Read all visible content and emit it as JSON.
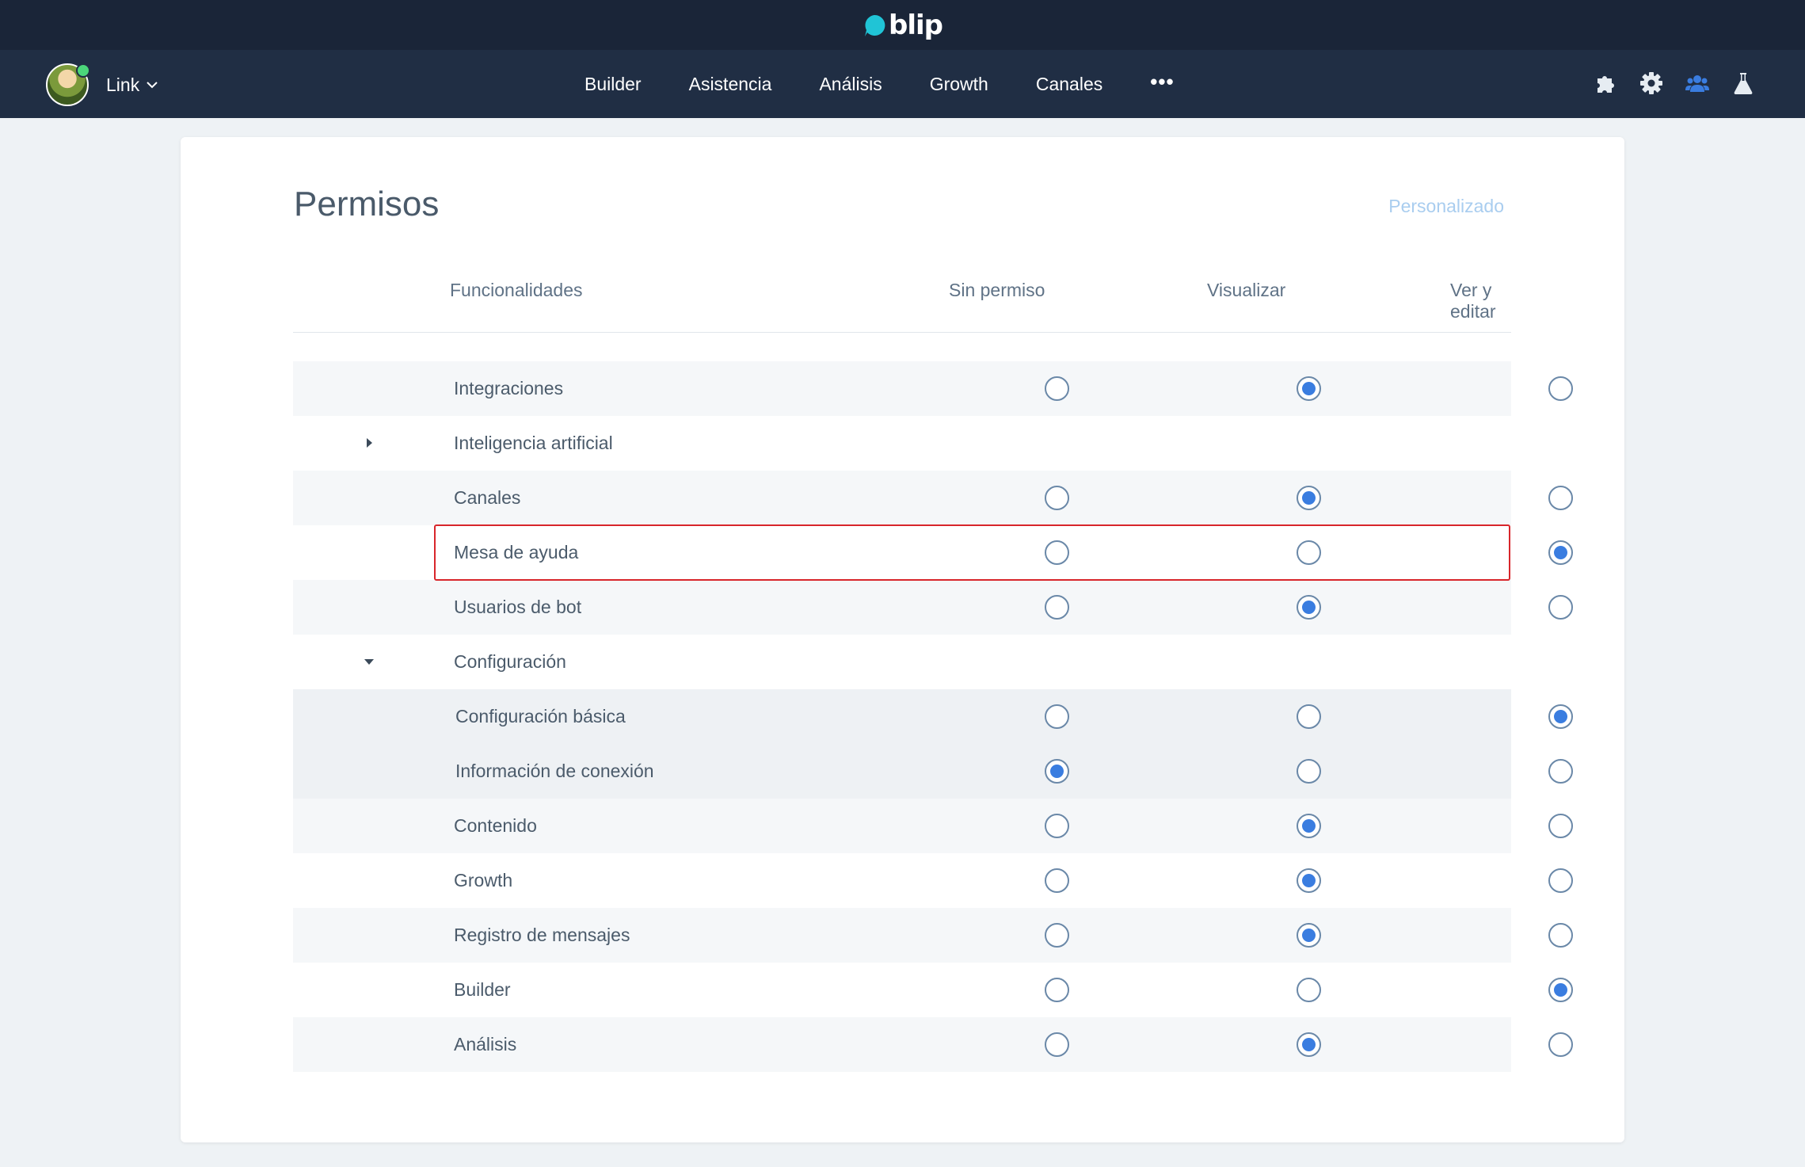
{
  "brand": {
    "name": "blip",
    "logo_icon": "blip-logo-icon",
    "accent": "#20c4d6"
  },
  "user": {
    "name": "Link",
    "status": "online"
  },
  "nav": {
    "links": [
      "Builder",
      "Asistencia",
      "Análisis",
      "Growth",
      "Canales"
    ],
    "more": "•••",
    "icons": [
      "puzzle-icon",
      "gear-icon",
      "team-icon",
      "flask-icon"
    ]
  },
  "page": {
    "title": "Permisos",
    "profile_label": "Personalizado",
    "columns": {
      "feature": "Funcionalidades",
      "none": "Sin permiso",
      "view": "Visualizar",
      "edit": "Ver y editar"
    },
    "rows": [
      {
        "label": "Integraciones",
        "value": "view",
        "style": "alt"
      },
      {
        "label": "Inteligencia artificial",
        "group": true,
        "expanded": false,
        "style": ""
      },
      {
        "label": "Canales",
        "value": "view",
        "style": "alt"
      },
      {
        "label": "Mesa de ayuda",
        "value": "edit",
        "style": "",
        "highlighted": true
      },
      {
        "label": "Usuarios de bot",
        "value": "view",
        "style": "alt"
      },
      {
        "label": "Configuración",
        "group": true,
        "expanded": true,
        "style": ""
      },
      {
        "label": "Configuración básica",
        "value": "edit",
        "style": "sub"
      },
      {
        "label": "Información de conexión",
        "value": "none",
        "style": "sub"
      },
      {
        "label": "Contenido",
        "value": "view",
        "style": "alt"
      },
      {
        "label": "Growth",
        "value": "view",
        "style": ""
      },
      {
        "label": "Registro de mensajes",
        "value": "view",
        "style": "alt"
      },
      {
        "label": "Builder",
        "value": "edit",
        "style": ""
      },
      {
        "label": "Análisis",
        "value": "view",
        "style": "alt"
      }
    ]
  }
}
